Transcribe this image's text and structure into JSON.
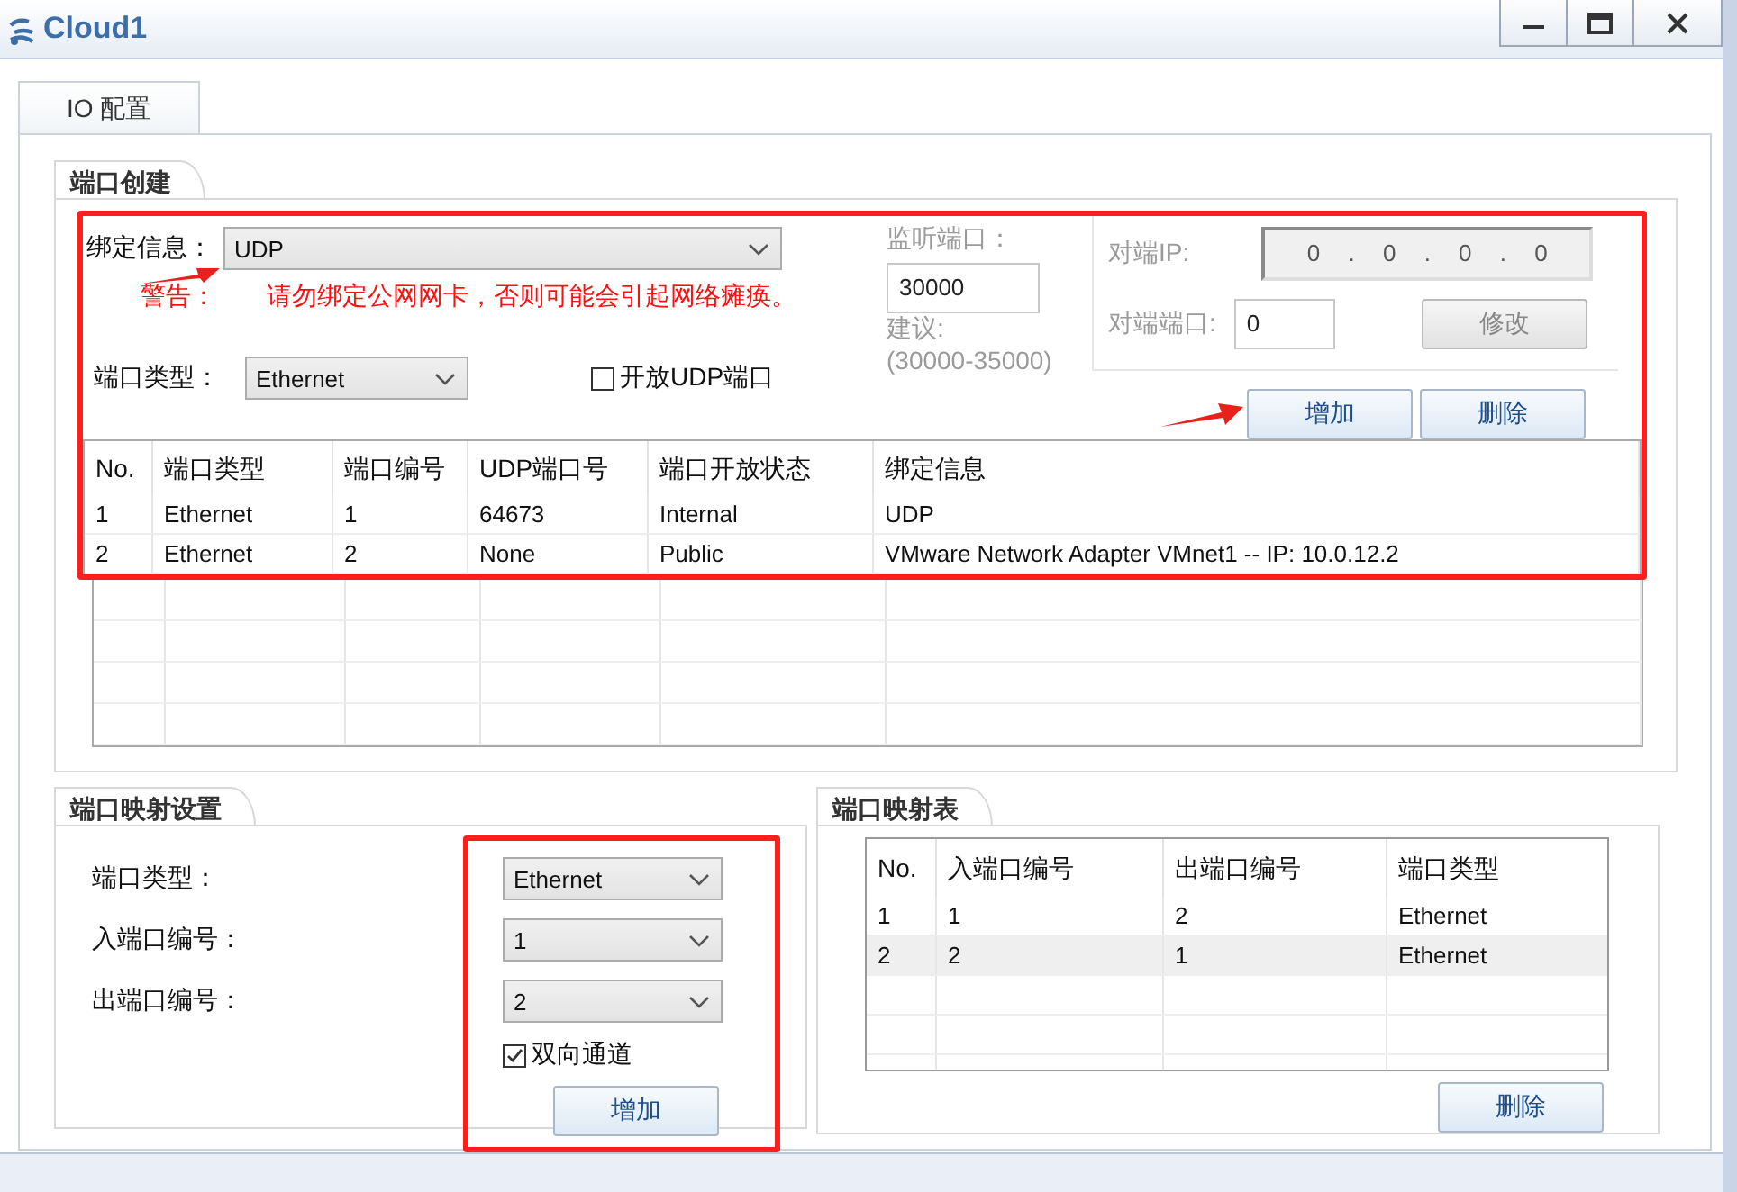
{
  "window": {
    "title": "Cloud1"
  },
  "tabs": [
    {
      "label": "IO 配置",
      "selected": true
    }
  ],
  "port_creation": {
    "title": "端口创建",
    "highlighted": true,
    "binding": {
      "label": "绑定信息：",
      "value": "UDP",
      "pointed": true
    },
    "warning": {
      "label": "警告：",
      "text": "请勿绑定公网网卡，否则可能会引起网络瘫痪。"
    },
    "port_type": {
      "label": "端口类型：",
      "value": "Ethernet"
    },
    "open_udp": {
      "label": "开放UDP端口",
      "checked": false
    },
    "listen_port": {
      "label": "监听端口：",
      "value": "30000",
      "hint": "建议:",
      "range": "(30000-35000)",
      "disabled": true
    },
    "peer": {
      "ip_label": "对端IP:",
      "ip": "0 . 0 . 0 . 0",
      "port_label": "对端端口:",
      "port": "0",
      "modify_button": "修改",
      "disabled": true
    },
    "buttons": [
      {
        "label": "增加",
        "pointed": true
      },
      {
        "label": "删除",
        "pointed": false
      }
    ],
    "table": {
      "columns": [
        "No.",
        "端口类型",
        "端口编号",
        "UDP端口号",
        "端口开放状态",
        "绑定信息"
      ],
      "rows": [
        {
          "cells": [
            "1",
            "Ethernet",
            "1",
            "64673",
            "Internal",
            "UDP"
          ],
          "selected": false
        },
        {
          "cells": [
            "2",
            "Ethernet",
            "2",
            "None",
            "Public",
            "VMware Network Adapter VMnet1 -- IP: 10.0.12.2"
          ],
          "selected": false
        }
      ]
    }
  },
  "port_mapping": {
    "title": "端口映射设置",
    "highlighted": true,
    "fields": [
      {
        "label": "端口类型：",
        "value": "Ethernet"
      },
      {
        "label": "入端口编号：",
        "value": "1"
      },
      {
        "label": "出端口编号：",
        "value": "2"
      }
    ],
    "bidirectional": {
      "label": "双向通道",
      "checked": true
    },
    "add_button": "增加"
  },
  "mapping_table": {
    "title": "端口映射表",
    "columns": [
      "No.",
      "入端口编号",
      "出端口编号",
      "端口类型"
    ],
    "rows": [
      {
        "cells": [
          "1",
          "1",
          "2",
          "Ethernet"
        ],
        "selected": false
      },
      {
        "cells": [
          "2",
          "2",
          "1",
          "Ethernet"
        ],
        "selected": true
      }
    ],
    "delete_button": "删除"
  }
}
